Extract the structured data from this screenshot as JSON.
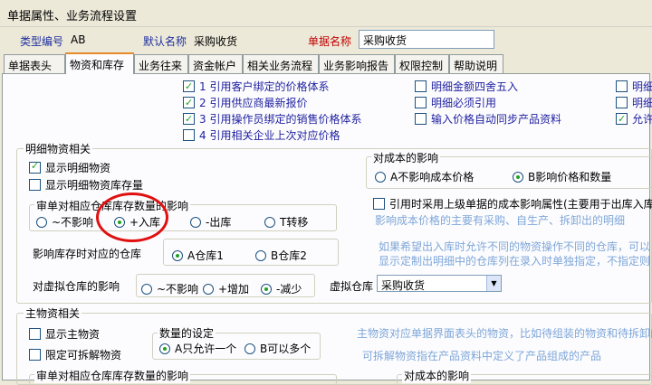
{
  "window": {
    "title": "单据属性、业务流程设置"
  },
  "header": {
    "type_code_label": "类型编号",
    "type_code_value": "AB",
    "default_name_label": "默认名称",
    "default_name_value": "采购收货",
    "doc_name_label": "单据名称",
    "doc_name_value": "采购收货"
  },
  "tabs": [
    "单据表头",
    "物资和库存",
    "业务往来",
    "资金帐户",
    "相关业务流程",
    "业务影响报告",
    "权限控制",
    "帮助说明"
  ],
  "top_options": {
    "col1": [
      {
        "label": "1 引用客户绑定的价格体系",
        "checked": true
      },
      {
        "label": "2 引用供应商最新报价",
        "checked": true
      },
      {
        "label": "3 引用操作员绑定的销售价格体系",
        "checked": true
      },
      {
        "label": "4 引用相关企业上次对应价格",
        "checked": false
      }
    ],
    "col2": [
      {
        "label": "明细金额四舍五入",
        "checked": false
      },
      {
        "label": "明细必须引用",
        "checked": false
      },
      {
        "label": "输入价格自动同步产品资料",
        "checked": false
      }
    ],
    "col3": [
      {
        "label": "明细",
        "checked": false
      },
      {
        "label": "明细",
        "checked": false
      },
      {
        "label": "允许",
        "checked": true
      }
    ]
  },
  "detail": {
    "title": "明细物资相关",
    "show_detail": {
      "label": "显示明细物资",
      "checked": true
    },
    "show_stock": {
      "label": "显示明细物资库存量",
      "checked": false
    },
    "stock_effect": {
      "title": "审单对相应仓库库存数量的影响",
      "options": [
        "~不影响",
        "+入库",
        "-出库",
        "T转移"
      ],
      "selected": 1
    },
    "warehouse": {
      "label": "影响库存时对应的仓库",
      "options": [
        "A仓库1",
        "B仓库2"
      ],
      "selected": 0
    },
    "virtual": {
      "label": "对虚拟仓库的影响",
      "options": [
        "~不影响",
        "+增加",
        "-减少"
      ],
      "selected": 2,
      "wh_label": "虚拟仓库",
      "wh_value": "采购收货"
    },
    "cost": {
      "title": "对成本的影响",
      "options": [
        "A不影响成本价格",
        "B影响价格和数量"
      ],
      "selected": 1
    },
    "upper_cost": {
      "label": "引用时采用上级单据的成本影响属性(主要用于出库入库",
      "checked": false
    },
    "note1": "影响成本价格的主要有采购、自生产、拆卸出的明细",
    "note2": "如果希望出入库时允许不同的物资操作不同的仓库，可以",
    "note3": "显示定制出明细中的仓库列在录入时单独指定，不指定则"
  },
  "main": {
    "title": "主物资相关",
    "show_main": {
      "label": "显示主物资",
      "checked": false
    },
    "limit_split": {
      "label": "限定可拆解物资",
      "checked": false
    },
    "qty": {
      "title": "数量的设定",
      "options": [
        "A只允许一个",
        "B可以多个"
      ],
      "selected": 0
    },
    "note1": "主物资对应单据界面表头的物资，比如待组装的物资和待拆卸的",
    "note2": "可拆解物资指在产品资料中定义了产品组成的产品",
    "bottom_group_title": "审单对相应仓库库存数量的影响",
    "bottom_cost_title": "对成本的影响"
  }
}
